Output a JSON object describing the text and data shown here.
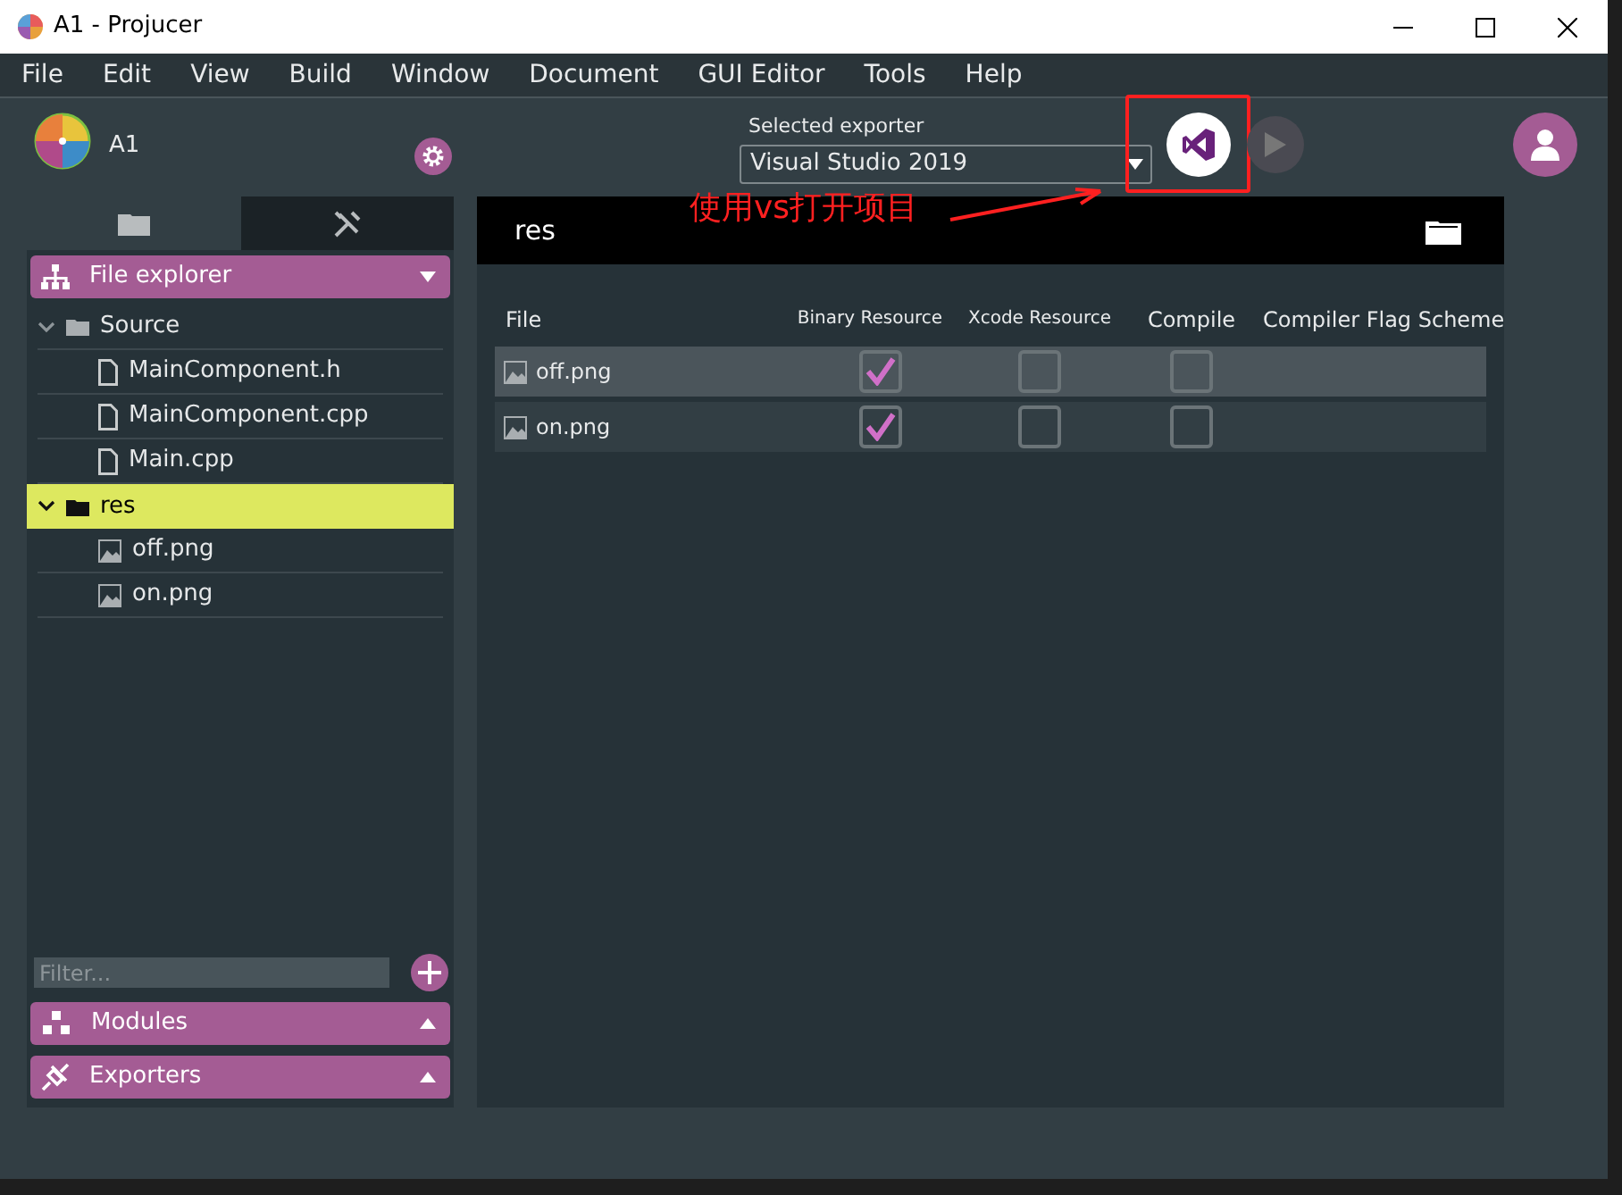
{
  "window": {
    "title": "A1 - Projucer"
  },
  "menu": [
    "File",
    "Edit",
    "View",
    "Build",
    "Window",
    "Document",
    "GUI Editor",
    "Tools",
    "Help"
  ],
  "project": {
    "name": "A1"
  },
  "exporter": {
    "label": "Selected exporter",
    "value": "Visual Studio 2019"
  },
  "annotation": {
    "text": "使用vs打开项目"
  },
  "sidebar": {
    "tabs": [
      {
        "kind": "files",
        "selected": true
      },
      {
        "kind": "tools",
        "selected": false
      }
    ],
    "file_explorer": {
      "title": "File explorer",
      "expanded": true
    },
    "tree": [
      {
        "name": "Source",
        "kind": "folder",
        "expanded": true,
        "selected": false,
        "children": [
          {
            "name": "MainComponent.h",
            "kind": "file",
            "selected": false
          },
          {
            "name": "MainComponent.cpp",
            "kind": "file",
            "selected": false
          },
          {
            "name": "Main.cpp",
            "kind": "file",
            "selected": false
          }
        ]
      },
      {
        "name": "res",
        "kind": "folder",
        "expanded": true,
        "selected": true,
        "children": [
          {
            "name": "off.png",
            "kind": "image",
            "selected": false
          },
          {
            "name": "on.png",
            "kind": "image",
            "selected": false
          }
        ]
      }
    ],
    "filter": {
      "placeholder": "Filter..."
    },
    "panels": [
      {
        "title": "Modules",
        "kind": "modules",
        "expanded": false
      },
      {
        "title": "Exporters",
        "kind": "exporters",
        "expanded": false
      }
    ]
  },
  "content": {
    "title": "res",
    "columns": [
      "File",
      "Binary Resource",
      "Xcode Resource",
      "Compile",
      "Compiler Flag Scheme"
    ],
    "rows": [
      {
        "file": "off.png",
        "selected": true,
        "binary": true,
        "xcode": false,
        "compile": false
      },
      {
        "file": "on.png",
        "selected": false,
        "binary": true,
        "xcode": false,
        "compile": false
      }
    ]
  }
}
